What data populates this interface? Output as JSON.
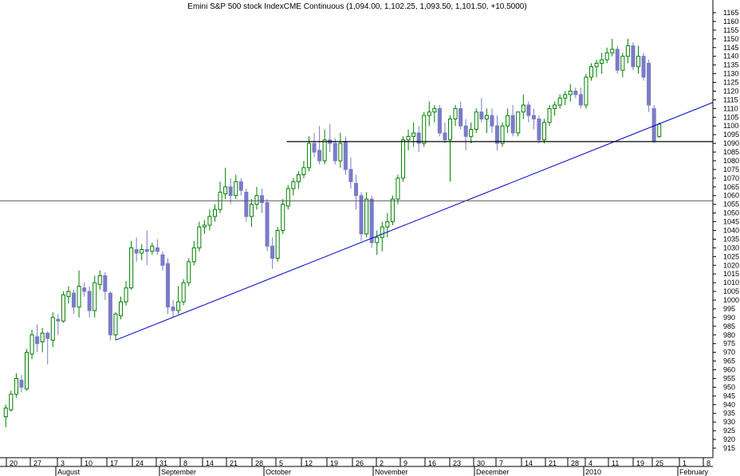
{
  "chart_data": {
    "type": "candlestick",
    "title": "Emini S&P 500 stock IndexCME Continuous (1,094.00, 1,102.25, 1,093.50, 1,101.50, +10.5000)",
    "ylim": [
      910,
      1170
    ],
    "y_ticks": [
      915,
      920,
      925,
      930,
      935,
      940,
      945,
      950,
      955,
      960,
      965,
      970,
      975,
      980,
      985,
      990,
      995,
      1000,
      1005,
      1010,
      1015,
      1020,
      1025,
      1030,
      1035,
      1040,
      1045,
      1050,
      1055,
      1060,
      1065,
      1070,
      1075,
      1080,
      1085,
      1090,
      1095,
      1100,
      1105,
      1110,
      1115,
      1120,
      1125,
      1130,
      1135,
      1140,
      1145,
      1150,
      1155,
      1160,
      1165
    ],
    "x_tick_labels": [
      "20",
      "27",
      "3",
      "10",
      "17",
      "24",
      "31",
      "8",
      "14",
      "21",
      "28",
      "5",
      "12",
      "19",
      "26",
      "2",
      "9",
      "16",
      "23",
      "30",
      "7",
      "14",
      "21",
      "28",
      "4",
      "11",
      "19",
      "25",
      "1",
      "8"
    ],
    "month_labels": [
      "August",
      "September",
      "October",
      "November",
      "December",
      "2010",
      "February"
    ],
    "grid": false,
    "colors": {
      "up": "#008000",
      "down": "#7b7bc8",
      "trendline": "#0000c8",
      "support": "#000000"
    },
    "candles": [
      {
        "o": 933,
        "h": 940,
        "l": 927,
        "c": 938
      },
      {
        "o": 937,
        "h": 948,
        "l": 936,
        "c": 946
      },
      {
        "o": 946,
        "h": 958,
        "l": 944,
        "c": 955
      },
      {
        "o": 954,
        "h": 957,
        "l": 947,
        "c": 950
      },
      {
        "o": 949,
        "h": 972,
        "l": 948,
        "c": 970
      },
      {
        "o": 969,
        "h": 983,
        "l": 966,
        "c": 980
      },
      {
        "o": 979,
        "h": 986,
        "l": 970,
        "c": 975
      },
      {
        "o": 976,
        "h": 984,
        "l": 970,
        "c": 981
      },
      {
        "o": 981,
        "h": 982,
        "l": 963,
        "c": 978
      },
      {
        "o": 977,
        "h": 993,
        "l": 973,
        "c": 990
      },
      {
        "o": 989,
        "h": 992,
        "l": 980,
        "c": 988
      },
      {
        "o": 988,
        "h": 1005,
        "l": 987,
        "c": 1003
      },
      {
        "o": 1002,
        "h": 1008,
        "l": 998,
        "c": 1005
      },
      {
        "o": 1004,
        "h": 1006,
        "l": 992,
        "c": 996
      },
      {
        "o": 996,
        "h": 1017,
        "l": 990,
        "c": 1008
      },
      {
        "o": 1007,
        "h": 1010,
        "l": 1002,
        "c": 1005
      },
      {
        "o": 1005,
        "h": 1008,
        "l": 990,
        "c": 994
      },
      {
        "o": 994,
        "h": 1014,
        "l": 990,
        "c": 1010
      },
      {
        "o": 1009,
        "h": 1017,
        "l": 1006,
        "c": 1014
      },
      {
        "o": 1014,
        "h": 1016,
        "l": 1000,
        "c": 1005
      },
      {
        "o": 1004,
        "h": 1005,
        "l": 977,
        "c": 980
      },
      {
        "o": 980,
        "h": 993,
        "l": 977,
        "c": 992
      },
      {
        "o": 991,
        "h": 1002,
        "l": 989,
        "c": 999
      },
      {
        "o": 999,
        "h": 1011,
        "l": 997,
        "c": 1007
      },
      {
        "o": 1007,
        "h": 1034,
        "l": 1006,
        "c": 1030
      },
      {
        "o": 1029,
        "h": 1036,
        "l": 1022,
        "c": 1027
      },
      {
        "o": 1027,
        "h": 1032,
        "l": 1023,
        "c": 1029
      },
      {
        "o": 1029,
        "h": 1040,
        "l": 1020,
        "c": 1028
      },
      {
        "o": 1028,
        "h": 1033,
        "l": 1026,
        "c": 1031
      },
      {
        "o": 1030,
        "h": 1035,
        "l": 1026,
        "c": 1028
      },
      {
        "o": 1026,
        "h": 1028,
        "l": 1017,
        "c": 1020
      },
      {
        "o": 1021,
        "h": 1024,
        "l": 992,
        "c": 996
      },
      {
        "o": 996,
        "h": 1000,
        "l": 990,
        "c": 994
      },
      {
        "o": 994,
        "h": 1008,
        "l": 992,
        "c": 999
      },
      {
        "o": 999,
        "h": 1012,
        "l": 997,
        "c": 1010
      },
      {
        "o": 1010,
        "h": 1024,
        "l": 1008,
        "c": 1022
      },
      {
        "o": 1022,
        "h": 1034,
        "l": 1020,
        "c": 1030
      },
      {
        "o": 1030,
        "h": 1045,
        "l": 1028,
        "c": 1042
      },
      {
        "o": 1042,
        "h": 1046,
        "l": 1038,
        "c": 1043
      },
      {
        "o": 1043,
        "h": 1052,
        "l": 1040,
        "c": 1048
      },
      {
        "o": 1048,
        "h": 1055,
        "l": 1045,
        "c": 1052
      },
      {
        "o": 1052,
        "h": 1068,
        "l": 1050,
        "c": 1062
      },
      {
        "o": 1061,
        "h": 1076,
        "l": 1058,
        "c": 1065
      },
      {
        "o": 1065,
        "h": 1070,
        "l": 1055,
        "c": 1060
      },
      {
        "o": 1060,
        "h": 1072,
        "l": 1058,
        "c": 1068
      },
      {
        "o": 1068,
        "h": 1070,
        "l": 1060,
        "c": 1063
      },
      {
        "o": 1062,
        "h": 1064,
        "l": 1045,
        "c": 1048
      },
      {
        "o": 1048,
        "h": 1058,
        "l": 1042,
        "c": 1055
      },
      {
        "o": 1055,
        "h": 1065,
        "l": 1052,
        "c": 1060
      },
      {
        "o": 1060,
        "h": 1064,
        "l": 1050,
        "c": 1056
      },
      {
        "o": 1056,
        "h": 1058,
        "l": 1028,
        "c": 1031
      },
      {
        "o": 1031,
        "h": 1036,
        "l": 1018,
        "c": 1024
      },
      {
        "o": 1024,
        "h": 1042,
        "l": 1022,
        "c": 1040
      },
      {
        "o": 1040,
        "h": 1058,
        "l": 1038,
        "c": 1055
      },
      {
        "o": 1054,
        "h": 1066,
        "l": 1052,
        "c": 1064
      },
      {
        "o": 1064,
        "h": 1070,
        "l": 1060,
        "c": 1068
      },
      {
        "o": 1068,
        "h": 1074,
        "l": 1064,
        "c": 1072
      },
      {
        "o": 1072,
        "h": 1080,
        "l": 1070,
        "c": 1076
      },
      {
        "o": 1076,
        "h": 1094,
        "l": 1074,
        "c": 1090
      },
      {
        "o": 1090,
        "h": 1096,
        "l": 1082,
        "c": 1085
      },
      {
        "o": 1086,
        "h": 1100,
        "l": 1078,
        "c": 1080
      },
      {
        "o": 1080,
        "h": 1098,
        "l": 1078,
        "c": 1092
      },
      {
        "o": 1092,
        "h": 1101,
        "l": 1085,
        "c": 1090
      },
      {
        "o": 1090,
        "h": 1093,
        "l": 1078,
        "c": 1080
      },
      {
        "o": 1080,
        "h": 1096,
        "l": 1076,
        "c": 1090
      },
      {
        "o": 1091,
        "h": 1094,
        "l": 1072,
        "c": 1075
      },
      {
        "o": 1075,
        "h": 1082,
        "l": 1064,
        "c": 1068
      },
      {
        "o": 1067,
        "h": 1072,
        "l": 1052,
        "c": 1060
      },
      {
        "o": 1060,
        "h": 1062,
        "l": 1034,
        "c": 1038
      },
      {
        "o": 1038,
        "h": 1062,
        "l": 1036,
        "c": 1058
      },
      {
        "o": 1058,
        "h": 1060,
        "l": 1030,
        "c": 1033
      },
      {
        "o": 1033,
        "h": 1040,
        "l": 1026,
        "c": 1036
      },
      {
        "o": 1036,
        "h": 1045,
        "l": 1028,
        "c": 1042
      },
      {
        "o": 1042,
        "h": 1050,
        "l": 1036,
        "c": 1045
      },
      {
        "o": 1045,
        "h": 1060,
        "l": 1043,
        "c": 1058
      },
      {
        "o": 1058,
        "h": 1072,
        "l": 1055,
        "c": 1070
      },
      {
        "o": 1070,
        "h": 1094,
        "l": 1068,
        "c": 1092
      },
      {
        "o": 1092,
        "h": 1098,
        "l": 1086,
        "c": 1094
      },
      {
        "o": 1094,
        "h": 1102,
        "l": 1088,
        "c": 1096
      },
      {
        "o": 1096,
        "h": 1100,
        "l": 1085,
        "c": 1090
      },
      {
        "o": 1090,
        "h": 1108,
        "l": 1088,
        "c": 1106
      },
      {
        "o": 1106,
        "h": 1114,
        "l": 1100,
        "c": 1108
      },
      {
        "o": 1108,
        "h": 1112,
        "l": 1102,
        "c": 1110
      },
      {
        "o": 1110,
        "h": 1112,
        "l": 1094,
        "c": 1096
      },
      {
        "o": 1096,
        "h": 1102,
        "l": 1090,
        "c": 1092
      },
      {
        "o": 1092,
        "h": 1106,
        "l": 1068,
        "c": 1104
      },
      {
        "o": 1104,
        "h": 1112,
        "l": 1100,
        "c": 1110
      },
      {
        "o": 1110,
        "h": 1114,
        "l": 1098,
        "c": 1100
      },
      {
        "o": 1100,
        "h": 1104,
        "l": 1086,
        "c": 1094
      },
      {
        "o": 1094,
        "h": 1102,
        "l": 1090,
        "c": 1098
      },
      {
        "o": 1098,
        "h": 1110,
        "l": 1096,
        "c": 1108
      },
      {
        "o": 1108,
        "h": 1116,
        "l": 1102,
        "c": 1104
      },
      {
        "o": 1104,
        "h": 1110,
        "l": 1096,
        "c": 1106
      },
      {
        "o": 1106,
        "h": 1110,
        "l": 1096,
        "c": 1100
      },
      {
        "o": 1100,
        "h": 1106,
        "l": 1086,
        "c": 1090
      },
      {
        "o": 1090,
        "h": 1102,
        "l": 1088,
        "c": 1100
      },
      {
        "o": 1100,
        "h": 1110,
        "l": 1096,
        "c": 1106
      },
      {
        "o": 1106,
        "h": 1112,
        "l": 1094,
        "c": 1096
      },
      {
        "o": 1096,
        "h": 1108,
        "l": 1094,
        "c": 1108
      },
      {
        "o": 1108,
        "h": 1118,
        "l": 1104,
        "c": 1112
      },
      {
        "o": 1112,
        "h": 1114,
        "l": 1102,
        "c": 1106
      },
      {
        "o": 1106,
        "h": 1110,
        "l": 1098,
        "c": 1104
      },
      {
        "o": 1104,
        "h": 1106,
        "l": 1090,
        "c": 1092
      },
      {
        "o": 1092,
        "h": 1104,
        "l": 1090,
        "c": 1102
      },
      {
        "o": 1102,
        "h": 1112,
        "l": 1100,
        "c": 1110
      },
      {
        "o": 1110,
        "h": 1114,
        "l": 1106,
        "c": 1112
      },
      {
        "o": 1112,
        "h": 1118,
        "l": 1110,
        "c": 1116
      },
      {
        "o": 1116,
        "h": 1120,
        "l": 1112,
        "c": 1118
      },
      {
        "o": 1118,
        "h": 1124,
        "l": 1114,
        "c": 1120
      },
      {
        "o": 1120,
        "h": 1122,
        "l": 1116,
        "c": 1118
      },
      {
        "o": 1118,
        "h": 1122,
        "l": 1110,
        "c": 1112
      },
      {
        "o": 1112,
        "h": 1130,
        "l": 1110,
        "c": 1128
      },
      {
        "o": 1128,
        "h": 1136,
        "l": 1126,
        "c": 1134
      },
      {
        "o": 1134,
        "h": 1138,
        "l": 1128,
        "c": 1136
      },
      {
        "o": 1136,
        "h": 1142,
        "l": 1130,
        "c": 1138
      },
      {
        "o": 1138,
        "h": 1145,
        "l": 1136,
        "c": 1142
      },
      {
        "o": 1142,
        "h": 1150,
        "l": 1140,
        "c": 1144
      },
      {
        "o": 1144,
        "h": 1146,
        "l": 1130,
        "c": 1132
      },
      {
        "o": 1132,
        "h": 1142,
        "l": 1128,
        "c": 1140
      },
      {
        "o": 1140,
        "h": 1150,
        "l": 1136,
        "c": 1146
      },
      {
        "o": 1146,
        "h": 1148,
        "l": 1132,
        "c": 1134
      },
      {
        "o": 1134,
        "h": 1146,
        "l": 1130,
        "c": 1140
      },
      {
        "o": 1140,
        "h": 1142,
        "l": 1126,
        "c": 1128
      },
      {
        "o": 1136,
        "h": 1138,
        "l": 1108,
        "c": 1112
      },
      {
        "o": 1110,
        "h": 1112,
        "l": 1090,
        "c": 1091
      },
      {
        "o": 1094,
        "h": 1102,
        "l": 1093,
        "c": 1101
      }
    ],
    "trendline": {
      "from": {
        "index": 21,
        "value": 977
      },
      "to": {
        "index": 129,
        "value": 1106
      }
    },
    "support_line": {
      "value": 1091,
      "from_index": 58
    },
    "reference_line": {
      "value": 1057
    }
  }
}
